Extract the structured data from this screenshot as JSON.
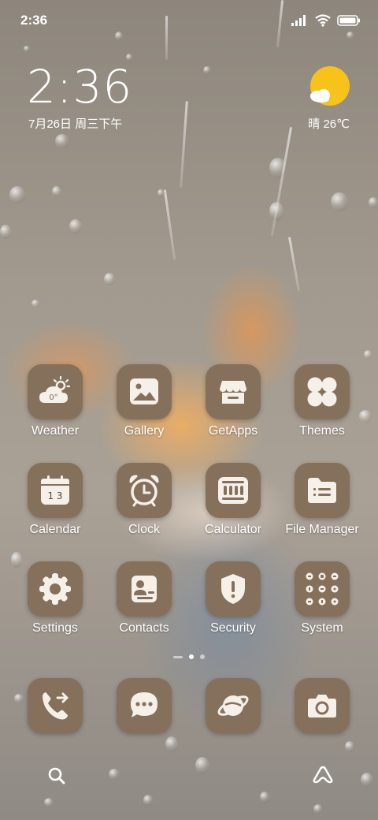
{
  "status_bar": {
    "time": "2:36"
  },
  "clock_widget": {
    "time": "2:36",
    "date": "7月26日 周三下午"
  },
  "weather_widget": {
    "text": "晴 26℃"
  },
  "apps": [
    {
      "label": "Weather",
      "icon": "weather-icon"
    },
    {
      "label": "Gallery",
      "icon": "gallery-icon"
    },
    {
      "label": "GetApps",
      "icon": "store-icon"
    },
    {
      "label": "Themes",
      "icon": "themes-icon"
    },
    {
      "label": "Calendar",
      "icon": "calendar-icon"
    },
    {
      "label": "Clock",
      "icon": "alarm-clock-icon"
    },
    {
      "label": "Calculator",
      "icon": "calculator-icon"
    },
    {
      "label": "File Manager",
      "icon": "folder-icon"
    },
    {
      "label": "Settings",
      "icon": "gear-icon"
    },
    {
      "label": "Contacts",
      "icon": "contacts-icon"
    },
    {
      "label": "Security",
      "icon": "shield-icon"
    },
    {
      "label": "System",
      "icon": "system-folder-icon"
    }
  ],
  "weather_app_icon_text": "0°",
  "calendar_icon_text": "1 3",
  "dock": [
    "phone-icon",
    "messages-icon",
    "browser-icon",
    "camera-icon"
  ],
  "colors": {
    "tile": "#85705c",
    "icon_fg": "#f5f0e8",
    "sun": "#f7c21a"
  }
}
